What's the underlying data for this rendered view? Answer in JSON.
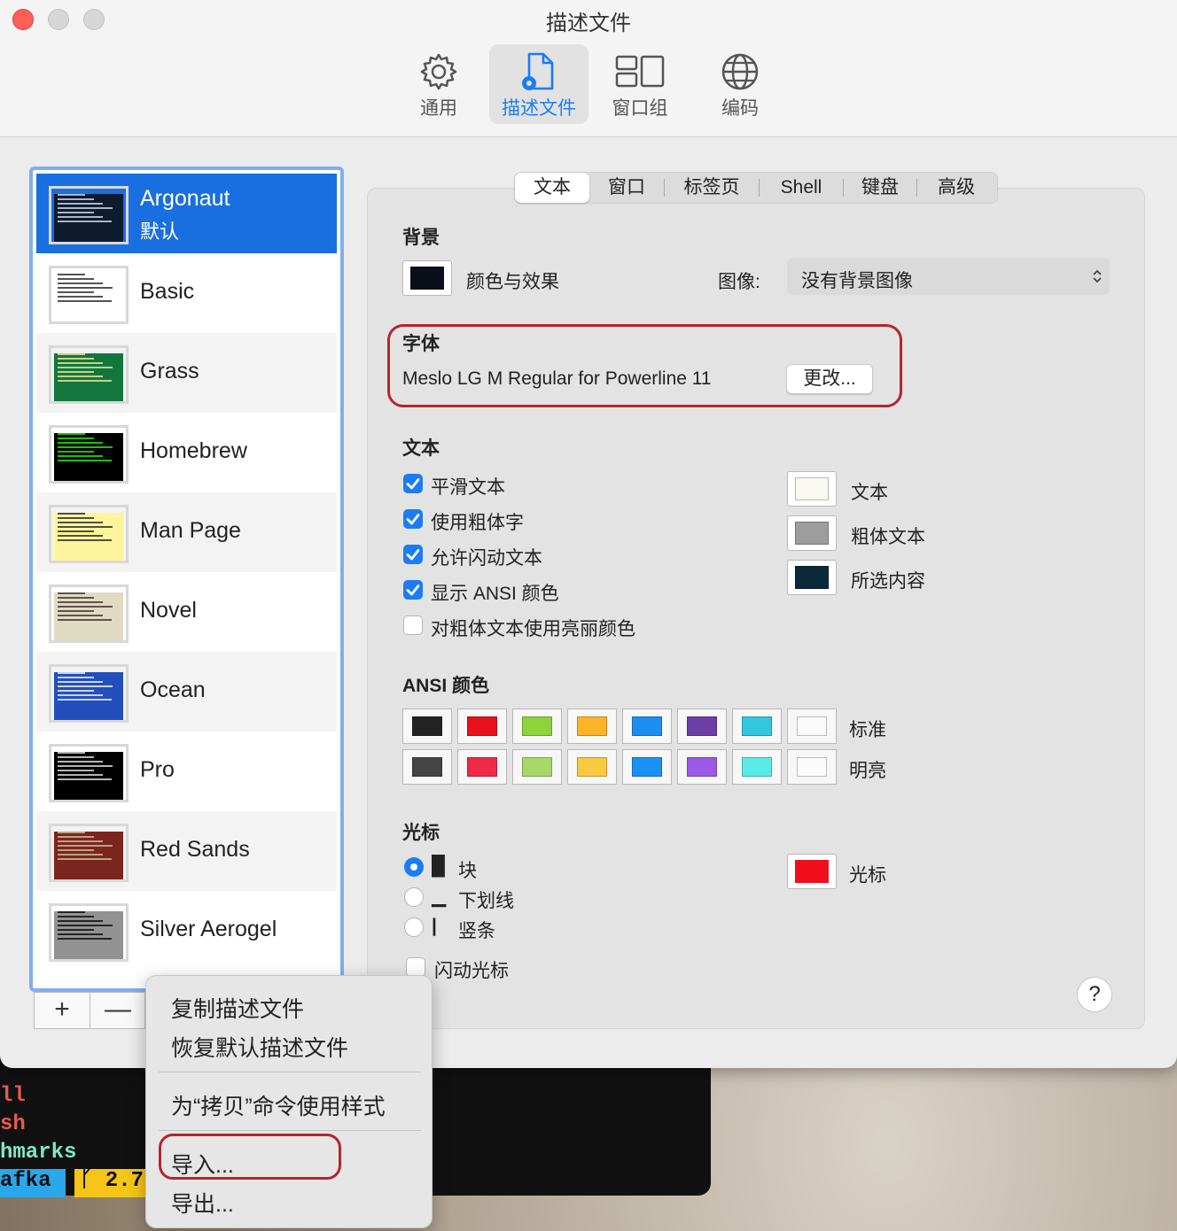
{
  "window": {
    "title": "描述文件"
  },
  "toolbar": [
    {
      "label": "通用",
      "icon": "gear-icon"
    },
    {
      "label": "描述文件",
      "icon": "profile-doc-icon",
      "active": true
    },
    {
      "label": "窗口组",
      "icon": "window-group-icon"
    },
    {
      "label": "编码",
      "icon": "globe-icon"
    }
  ],
  "profiles": [
    {
      "name": "Argonaut",
      "sub": "默认",
      "bg": "#0e1a2e",
      "fg": "#dfe8ff"
    },
    {
      "name": "Basic",
      "bg": "#ffffff",
      "fg": "#1a1a1a"
    },
    {
      "name": "Grass",
      "bg": "#13773d",
      "fg": "#fff0a5"
    },
    {
      "name": "Homebrew",
      "bg": "#000000",
      "fg": "#28fe14"
    },
    {
      "name": "Man Page",
      "bg": "#fef49c",
      "fg": "#1a1a1a"
    },
    {
      "name": "Novel",
      "bg": "#dfdbc3",
      "fg": "#3b2322"
    },
    {
      "name": "Ocean",
      "bg": "#224fbc",
      "fg": "#ffffff"
    },
    {
      "name": "Pro",
      "bg": "#000000",
      "fg": "#f2f2f2"
    },
    {
      "name": "Red Sands",
      "bg": "#7a251e",
      "fg": "#d7c9a7"
    },
    {
      "name": "Silver Aerogel",
      "bg": "#929292",
      "fg": "#000000"
    }
  ],
  "list_buttons": {
    "add": "+",
    "remove": "—"
  },
  "tabs": [
    "文本",
    "窗口",
    "标签页",
    "Shell",
    "键盘",
    "高级"
  ],
  "background": {
    "heading": "背景",
    "color_label": "颜色与效果",
    "color": "#0b0f1a",
    "image_label": "图像:",
    "image_value": "没有背景图像"
  },
  "font": {
    "heading": "字体",
    "value": "Meslo LG M Regular for Powerline 11",
    "change_button": "更改..."
  },
  "text": {
    "heading": "文本",
    "options": [
      {
        "label": "平滑文本",
        "checked": true
      },
      {
        "label": "使用粗体字",
        "checked": true
      },
      {
        "label": "允许闪动文本",
        "checked": true
      },
      {
        "label": "显示 ANSI 颜色",
        "checked": true
      },
      {
        "label": "对粗体文本使用亮丽颜色",
        "checked": false
      }
    ],
    "colors": [
      {
        "label": "文本",
        "color": "#faf8f2"
      },
      {
        "label": "粗体文本",
        "color": "#9d9d9d"
      },
      {
        "label": "所选内容",
        "color": "#0a2a3a"
      }
    ]
  },
  "ansi": {
    "heading": "ANSI 颜色",
    "normal_label": "标准",
    "bright_label": "明亮",
    "normal": [
      "#232323",
      "#e8101c",
      "#8ed23c",
      "#fbb427",
      "#1b8ef0",
      "#6b3fa5",
      "#33c7de",
      "#fafafa"
    ],
    "bright": [
      "#444444",
      "#ee2a46",
      "#a8d868",
      "#fbc93f",
      "#1b90f5",
      "#9b59e6",
      "#59ebe6",
      "#fbfbfb"
    ]
  },
  "cursor": {
    "heading": "光标",
    "options": [
      {
        "glyph": "█",
        "label": "块",
        "selected": true
      },
      {
        "glyph": "▁",
        "label": "下划线",
        "selected": false
      },
      {
        "glyph": "|",
        "label": "竖条",
        "selected": false
      }
    ],
    "blink_label": "闪动光标",
    "color_label": "光标",
    "color": "#f10e1c"
  },
  "help": "?",
  "context_menu": [
    "复制描述文件",
    "恢复默认描述文件",
    "为“拷贝”命令使用样式",
    "导入...",
    "导出..."
  ],
  "terminal_lines": [
    {
      "text": "ll",
      "color": "#e85a4f"
    },
    {
      "text": "sh",
      "color": "#e85a4f"
    },
    {
      "text": "hmarks",
      "color": "#7ee8c4"
    },
    {
      "text": "afka",
      "color": "#111"
    },
    {
      "text": "ᚴ 2.7",
      "color": "#111"
    }
  ]
}
